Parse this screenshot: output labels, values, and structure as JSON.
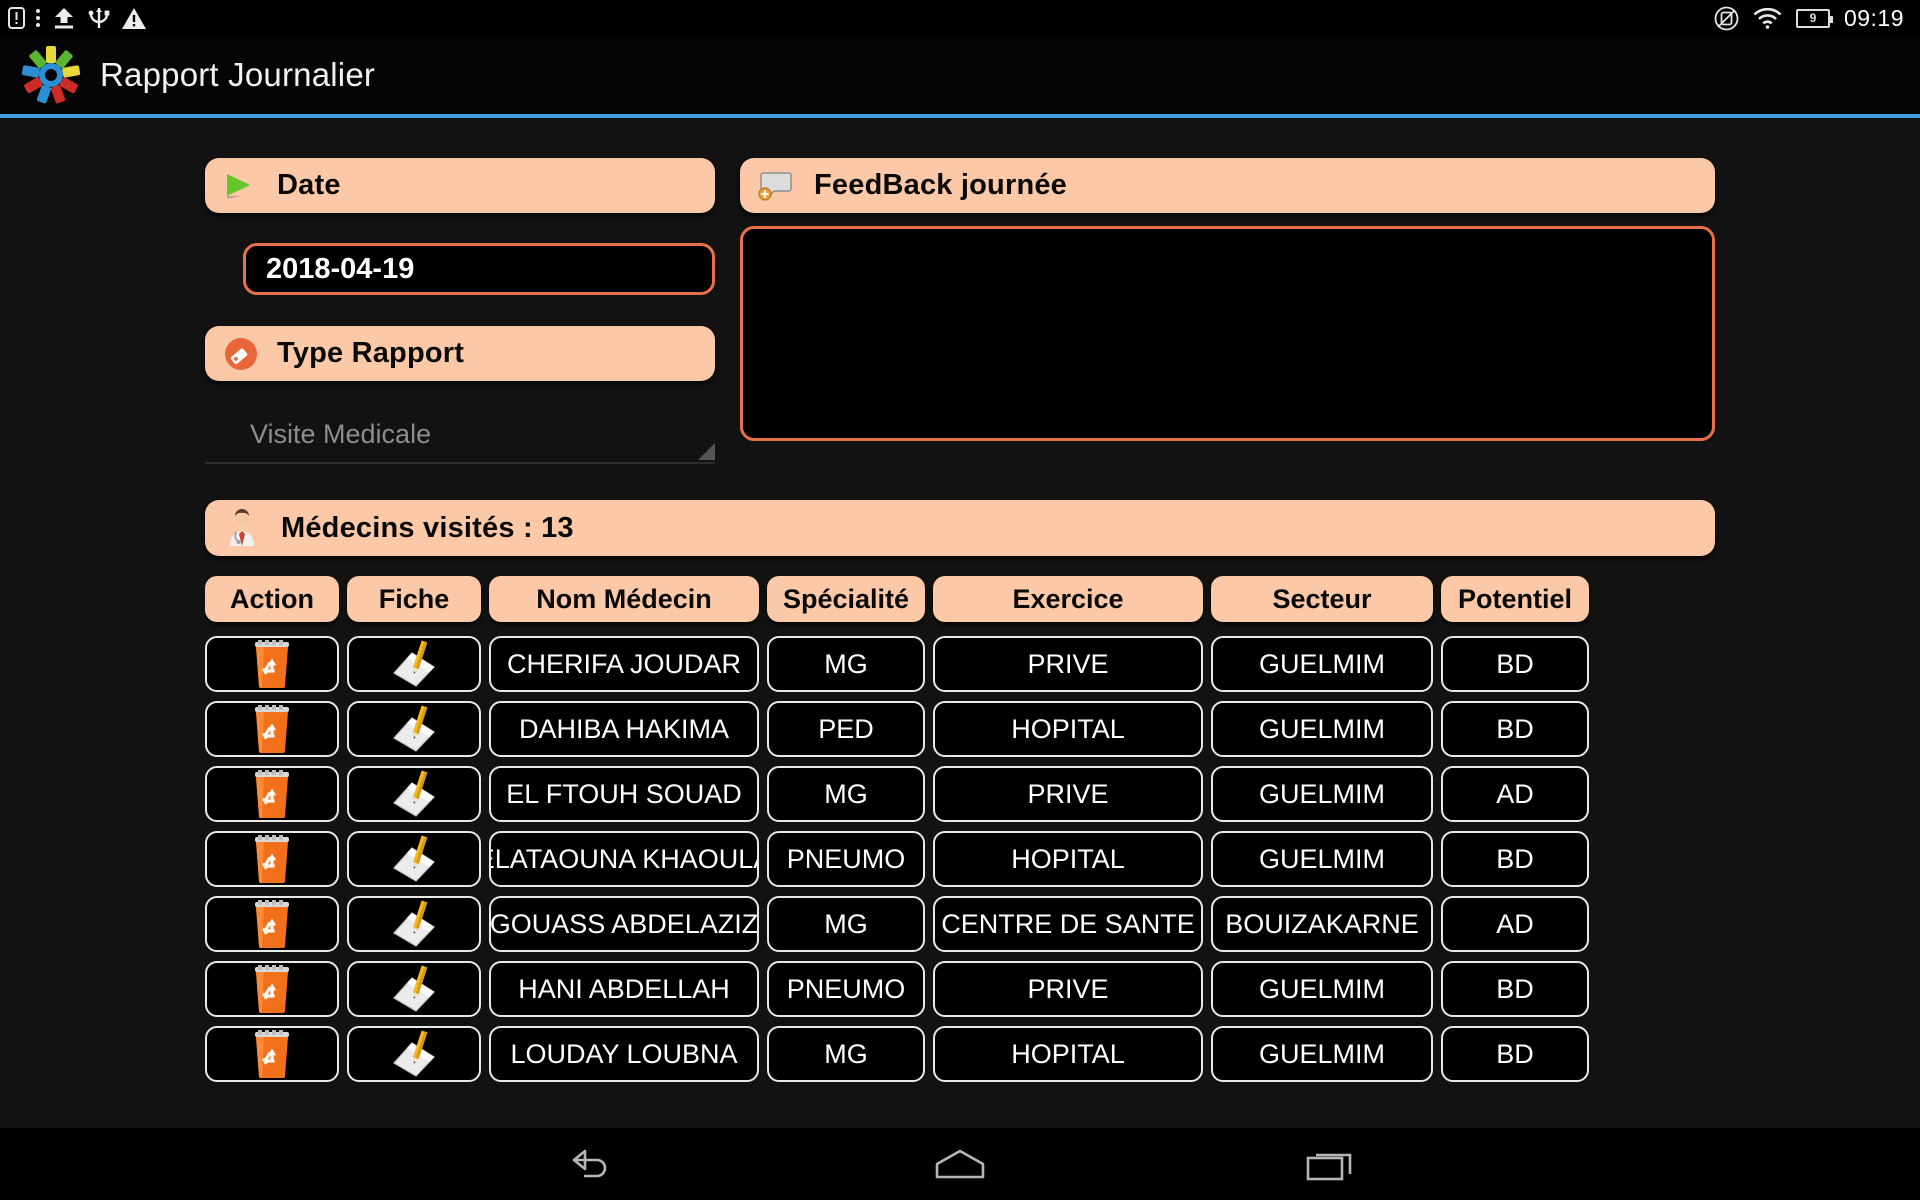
{
  "statusbar": {
    "left_icons": [
      "sim-card-icon",
      "more-vert-icon",
      "upload-icon",
      "usb-icon",
      "warning-icon"
    ],
    "right_icons": [
      "rotation-locked-icon",
      "wifi-icon"
    ],
    "battery_level": "9",
    "clock": "09:19"
  },
  "titlebar": {
    "logo": "app-burst-logo",
    "title": "Rapport Journalier",
    "accent_color": "#3d9fdc"
  },
  "form": {
    "date": {
      "icon": "play-triangle-icon",
      "label": "Date",
      "value": "2018-04-19"
    },
    "type_rapport": {
      "icon": "tag-icon",
      "label": "Type Rapport",
      "selected": "Visite Medicale",
      "options": [
        "Visite Medicale"
      ]
    },
    "feedback": {
      "icon": "comment-bubble-icon",
      "label": "FeedBack journée",
      "value": "",
      "placeholder": ""
    }
  },
  "doctors_bar": {
    "icon": "doctor-avatar-icon",
    "label": "Médecins visités : 13"
  },
  "table": {
    "columns": [
      "Action",
      "Fiche",
      "Nom Médecin",
      "Spécialité",
      "Exercice",
      "Secteur",
      "Potentiel"
    ],
    "row_icons": {
      "delete": "trash-recycle-icon",
      "edit": "notepad-pencil-icon"
    },
    "rows": [
      {
        "nom": "CHERIFA JOUDAR",
        "specialite": "MG",
        "exercice": "PRIVE",
        "secteur": "GUELMIM",
        "potentiel": "BD"
      },
      {
        "nom": "DAHIBA HAKIMA",
        "specialite": "PED",
        "exercice": "HOPITAL",
        "secteur": "GUELMIM",
        "potentiel": "BD"
      },
      {
        "nom": "EL FTOUH SOUAD",
        "specialite": "MG",
        "exercice": "PRIVE",
        "secteur": "GUELMIM",
        "potentiel": "AD"
      },
      {
        "nom": "ELATAOUNA KHAOULA",
        "specialite": "PNEUMO",
        "exercice": "HOPITAL",
        "secteur": "GUELMIM",
        "potentiel": "BD"
      },
      {
        "nom": "GOUASS ABDELAZIZ",
        "specialite": "MG",
        "exercice": "CENTRE DE SANTE",
        "secteur": "BOUIZAKARNE",
        "potentiel": "AD"
      },
      {
        "nom": "HANI ABDELLAH",
        "specialite": "PNEUMO",
        "exercice": "PRIVE",
        "secteur": "GUELMIM",
        "potentiel": "BD"
      },
      {
        "nom": "LOUDAY LOUBNA",
        "specialite": "MG",
        "exercice": "HOPITAL",
        "secteur": "GUELMIM",
        "potentiel": "BD"
      }
    ]
  },
  "navbar": {
    "back": "back-icon",
    "home": "home-icon",
    "recents": "recents-icon"
  },
  "colors": {
    "pill": "#fbc9a7",
    "field_border": "#e8714c",
    "accent": "#3d9fdc",
    "background": "#121212"
  }
}
